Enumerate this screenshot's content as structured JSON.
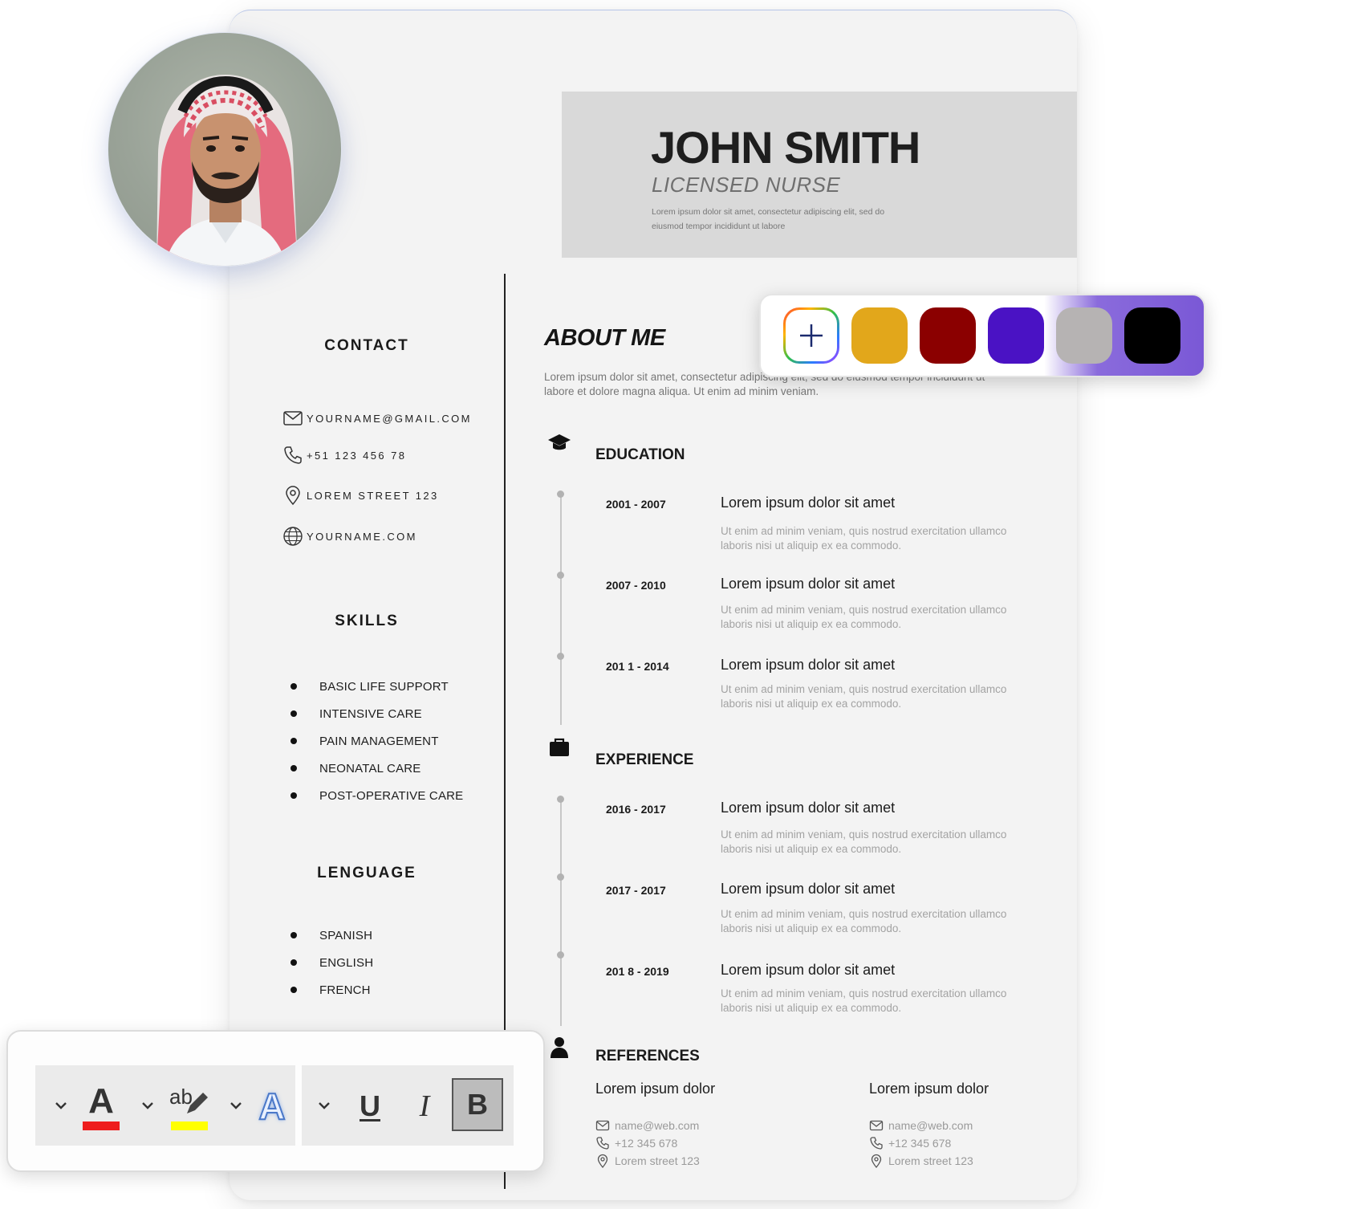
{
  "resume": {
    "name": "JOHN SMITH",
    "job_title": "LICENSED NURSE",
    "header_description": "Lorem ipsum dolor sit amet, consectetur adipiscing elit, sed do eiusmod tempor incididunt ut labore",
    "contact": {
      "title": "CONTACT",
      "email": "YOURNAME@GMAIL.COM",
      "phone": "+51 123 456 78",
      "address": "LOREM STREET 123",
      "website": "YOURNAME.COM"
    },
    "skills": {
      "title": "SKILLS",
      "items": [
        "BASIC LIFE SUPPORT",
        "INTENSIVE CARE",
        "PAIN MANAGEMENT",
        "NEONATAL CARE",
        "POST-OPERATIVE CARE"
      ]
    },
    "language": {
      "title": "LENGUAGE",
      "items": [
        "SPANISH",
        "ENGLISH",
        "FRENCH"
      ]
    },
    "about": {
      "title": "ABOUT ME",
      "text": "Lorem ipsum dolor sit amet, consectetur adipiscing elit, sed do eiusmod tempor incididunt ut labore et dolore magna aliqua. Ut enim ad minim veniam."
    },
    "education": {
      "title": "EDUCATION",
      "entries": [
        {
          "years": "2001 - 2007",
          "heading": "Lorem ipsum dolor sit amet",
          "desc": "Ut enim ad minim veniam, quis nostrud exercitation ullamco laboris nisi ut aliquip ex ea commodo."
        },
        {
          "years": "2007 - 2010",
          "heading": "Lorem ipsum dolor sit amet",
          "desc": "Ut enim ad minim veniam, quis nostrud exercitation ullamco laboris nisi ut aliquip ex ea commodo."
        },
        {
          "years": "201 1 - 2014",
          "heading": "Lorem ipsum dolor sit amet",
          "desc": "Ut enim ad minim veniam, quis nostrud exercitation ullamco laboris nisi ut aliquip ex ea commodo."
        }
      ]
    },
    "experience": {
      "title": "EXPERIENCE",
      "entries": [
        {
          "years": "2016 - 2017",
          "heading": "Lorem ipsum dolor sit amet",
          "desc": "Ut enim ad minim veniam, quis nostrud exercitation ullamco laboris nisi ut aliquip ex ea commodo."
        },
        {
          "years": "2017 - 2017",
          "heading": "Lorem ipsum dolor sit amet",
          "desc": "Ut enim ad minim veniam, quis nostrud exercitation ullamco laboris nisi ut aliquip ex ea commodo."
        },
        {
          "years": "201 8 - 2019",
          "heading": "Lorem ipsum dolor sit amet",
          "desc": "Ut enim ad minim veniam, quis nostrud exercitation ullamco laboris nisi ut aliquip ex ea commodo."
        }
      ]
    },
    "references": {
      "title": "REFERENCES",
      "items": [
        {
          "name": "Lorem ipsum dolor",
          "email": "name@web.com",
          "phone": "+12 345 678",
          "address": "Lorem street 123"
        },
        {
          "name": "Lorem ipsum dolor",
          "email": "name@web.com",
          "phone": "+12 345 678",
          "address": "Lorem street 123"
        }
      ]
    }
  },
  "palette": {
    "add_icon": "plus-icon",
    "swatches": [
      "#e2a71b",
      "#8b0000",
      "#4a12c4",
      "#b6b3b3",
      "#000000"
    ]
  },
  "toolbar": {
    "font_color": {
      "glyph": "A",
      "underline_color": "#ee1d1d"
    },
    "highlight": {
      "glyph": "ab",
      "underline_color": "#ffff00"
    },
    "text_effects": {
      "glyph": "A"
    },
    "underline": {
      "glyph": "U"
    },
    "italic": {
      "glyph": "I"
    },
    "bold": {
      "glyph": "B"
    }
  }
}
